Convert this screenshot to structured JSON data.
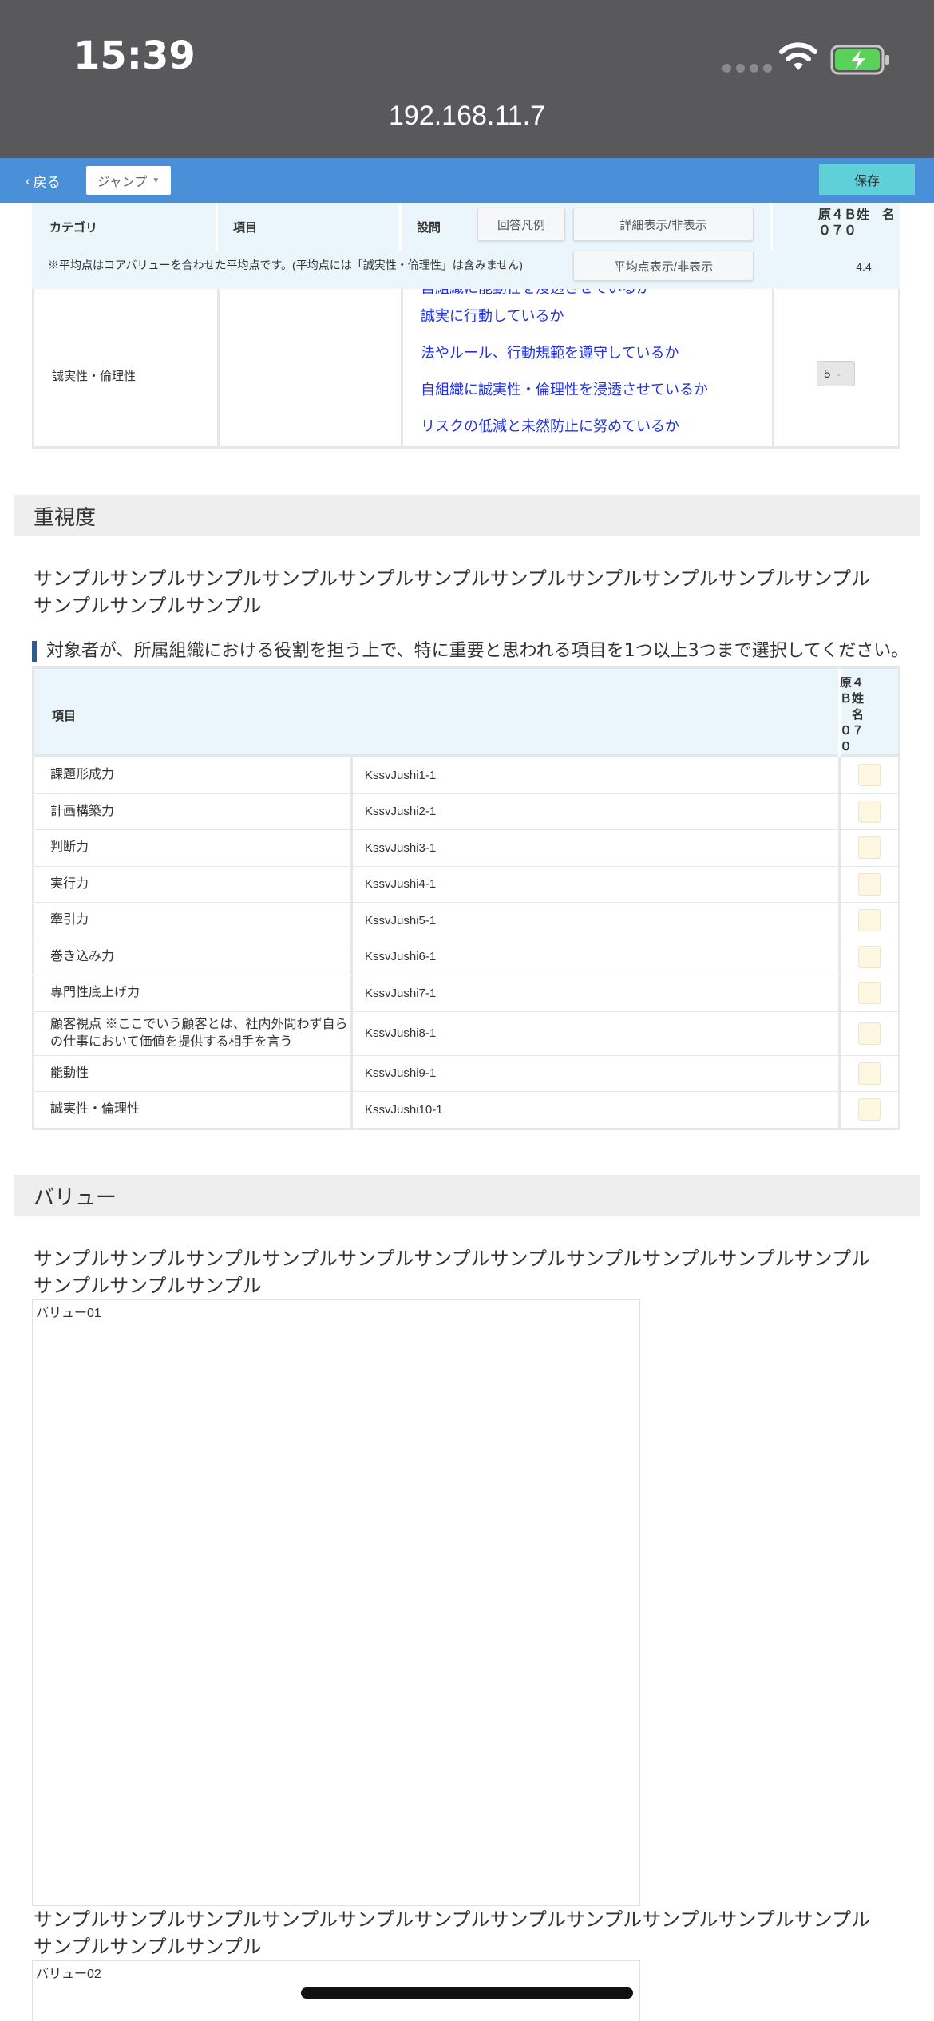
{
  "status": {
    "time": "15:39",
    "url": "192.168.11.7"
  },
  "toolbar": {
    "back_label": "戻る",
    "jump_label": "ジャンプ",
    "save_label": "保存"
  },
  "eval_table": {
    "headers": {
      "category": "カテゴリ",
      "item": "項目",
      "question": "設問"
    },
    "buttons": {
      "legend": "回答凡例",
      "detail_toggle": "詳細表示/非表示",
      "average_toggle": "平均点表示/非表示"
    },
    "person_header": "原４Ｂ姓　名０７０",
    "note": "※平均点はコアバリューを合わせた平均点です。(平均点には「誠実性・倫理性」は含みません)",
    "average": "4.4",
    "row": {
      "category": "誠実性・倫理性",
      "cut_question": "自組織に能動性を浸透させているか",
      "questions": [
        "誠実に行動しているか",
        "法やルール、行動規範を遵守しているか",
        "自組織に誠実性・倫理性を浸透させているか",
        "リスクの低減と未然防止に努めているか"
      ],
      "score": "5"
    }
  },
  "importance": {
    "section_title": "重視度",
    "sample": "サンプルサンプルサンプルサンプルサンプルサンプルサンプルサンプルサンプルサンプルサンプルサンプルサンプルサンプル",
    "question": "対象者が、所属組織における役割を担う上で、特に重要と思われる項目を1つ以上3つまで選択してください。",
    "header_item": "項目",
    "header_person": "原４\nＢ姓\n　名\n０７\n０",
    "rows": [
      {
        "name": "課題形成力",
        "key": "KssvJushi1-1"
      },
      {
        "name": "計画構築力",
        "key": "KssvJushi2-1"
      },
      {
        "name": "判断力",
        "key": "KssvJushi3-1"
      },
      {
        "name": "実行力",
        "key": "KssvJushi4-1"
      },
      {
        "name": "牽引力",
        "key": "KssvJushi5-1"
      },
      {
        "name": "巻き込み力",
        "key": "KssvJushi6-1"
      },
      {
        "name": "専門性底上げ力",
        "key": "KssvJushi7-1"
      },
      {
        "name": "顧客視点 ※ここでいう顧客とは、社内外問わず自らの仕事において価値を提供する相手を言う",
        "key": "KssvJushi8-1"
      },
      {
        "name": "能動性",
        "key": "KssvJushi9-1"
      },
      {
        "name": "誠実性・倫理性",
        "key": "KssvJushi10-1"
      }
    ]
  },
  "value": {
    "section_title": "バリュー",
    "sample1": "サンプルサンプルサンプルサンプルサンプルサンプルサンプルサンプルサンプルサンプルサンプルサンプルサンプルサンプル",
    "box1_label": "バリュー01",
    "sample2": "サンプルサンプルサンプルサンプルサンプルサンプルサンプルサンプルサンプルサンプルサンプルサンプルサンプルサンプル",
    "box2_label": "バリュー02"
  },
  "colors": {
    "toolbar": "#4a90d9",
    "save": "#5fd0d8",
    "link": "#2233dd",
    "header_bg": "#eaf6fb",
    "checkbox": "#fdf6e0"
  }
}
